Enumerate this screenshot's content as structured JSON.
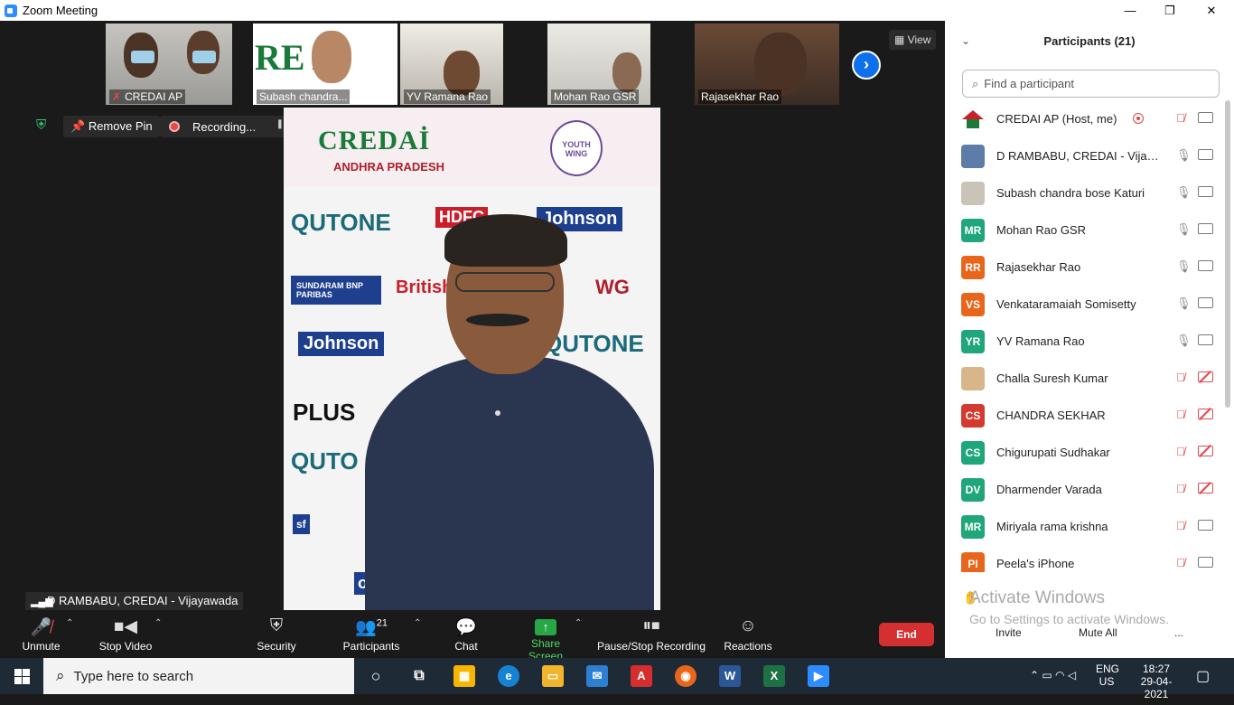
{
  "window": {
    "title": "Zoom Meeting",
    "minimize": "—",
    "restore": "❐",
    "close": "✕"
  },
  "thumbnails": [
    {
      "name": "CREDAI AP",
      "muted": true
    },
    {
      "name": "Subash chandra...",
      "muted": false
    },
    {
      "name": "YV Ramana Rao",
      "muted": false
    },
    {
      "name": "Mohan Rao GSR",
      "muted": false
    },
    {
      "name": "Rajasekhar Rao",
      "muted": false
    }
  ],
  "view_label": "View",
  "remove_pin_label": "Remove Pin",
  "recording_label": "Recording...",
  "speaker_label": "D RAMBABU, CREDAI - Vijayawada",
  "banner": {
    "credai": "CREDAİ",
    "state": "ANDHRA PRADESH",
    "youth": "YOUTH WING",
    "sponsors": [
      "QUTONE",
      "HDFC",
      "Johnson",
      "SUNDARAM BNP PARIBAS",
      "British",
      "WG",
      "Johnson",
      "QUTONE",
      "PLUS",
      "QUTO",
      "sf",
      "on"
    ]
  },
  "toolbar": {
    "unmute": "Unmute",
    "stop_video": "Stop Video",
    "security": "Security",
    "participants": "Participants",
    "participants_count": "21",
    "chat": "Chat",
    "share_screen": "Share Screen",
    "pause_stop_recording": "Pause/Stop Recording",
    "reactions": "Reactions",
    "end": "End"
  },
  "panel": {
    "title": "Participants (21)",
    "search_placeholder": "Find a participant",
    "participants": [
      {
        "name": "CREDAI AP (Host, me)",
        "initials": "",
        "color": "#ffffff",
        "mic": "muted",
        "cam": "on",
        "recording": true,
        "avatar": "logo"
      },
      {
        "name": "D RAMBABU, CREDAI - Vijayawa...",
        "initials": "",
        "color": "#5d7ca8",
        "mic": "on",
        "cam": "on",
        "recording": false,
        "avatar": "photo"
      },
      {
        "name": "Subash chandra bose Katuri",
        "initials": "",
        "color": "#c9c3b8",
        "mic": "on",
        "cam": "on",
        "recording": false,
        "avatar": "photo"
      },
      {
        "name": "Mohan Rao GSR",
        "initials": "MR",
        "color": "#1fa67a",
        "mic": "on",
        "cam": "on",
        "recording": false
      },
      {
        "name": "Rajasekhar Rao",
        "initials": "RR",
        "color": "#e8661b",
        "mic": "on",
        "cam": "on",
        "recording": false
      },
      {
        "name": "Venkataramaiah Somisetty",
        "initials": "VS",
        "color": "#e8661b",
        "mic": "on",
        "cam": "on",
        "recording": false
      },
      {
        "name": "YV Ramana Rao",
        "initials": "YR",
        "color": "#1fa67a",
        "mic": "on",
        "cam": "on",
        "recording": false
      },
      {
        "name": "Challa Suresh Kumar",
        "initials": "",
        "color": "#d9b58a",
        "mic": "muted",
        "cam": "off",
        "recording": false,
        "avatar": "photo"
      },
      {
        "name": "CHANDRA SEKHAR",
        "initials": "CS",
        "color": "#d43a2f",
        "mic": "muted",
        "cam": "off",
        "recording": false
      },
      {
        "name": "Chigurupati Sudhakar",
        "initials": "CS",
        "color": "#1fa67a",
        "mic": "muted",
        "cam": "off",
        "recording": false
      },
      {
        "name": "Dharmender Varada",
        "initials": "DV",
        "color": "#1fa67a",
        "mic": "muted",
        "cam": "off",
        "recording": false
      },
      {
        "name": "Miriyala rama krishna",
        "initials": "MR",
        "color": "#1fa67a",
        "mic": "muted",
        "cam": "on",
        "recording": false
      },
      {
        "name": "Peela's iPhone",
        "initials": "PI",
        "color": "#e8661b",
        "mic": "muted",
        "cam": "on",
        "recording": false
      }
    ],
    "footer": {
      "invite": "Invite",
      "mute_all": "Mute All",
      "more": "..."
    },
    "watermark_title": "Activate Windows",
    "watermark_sub": "Go to Settings to activate Windows."
  },
  "taskbar": {
    "search_placeholder": "Type here to search",
    "lang_top": "ENG",
    "lang_bottom": "US",
    "time": "18:27",
    "date": "29-04-2021"
  }
}
